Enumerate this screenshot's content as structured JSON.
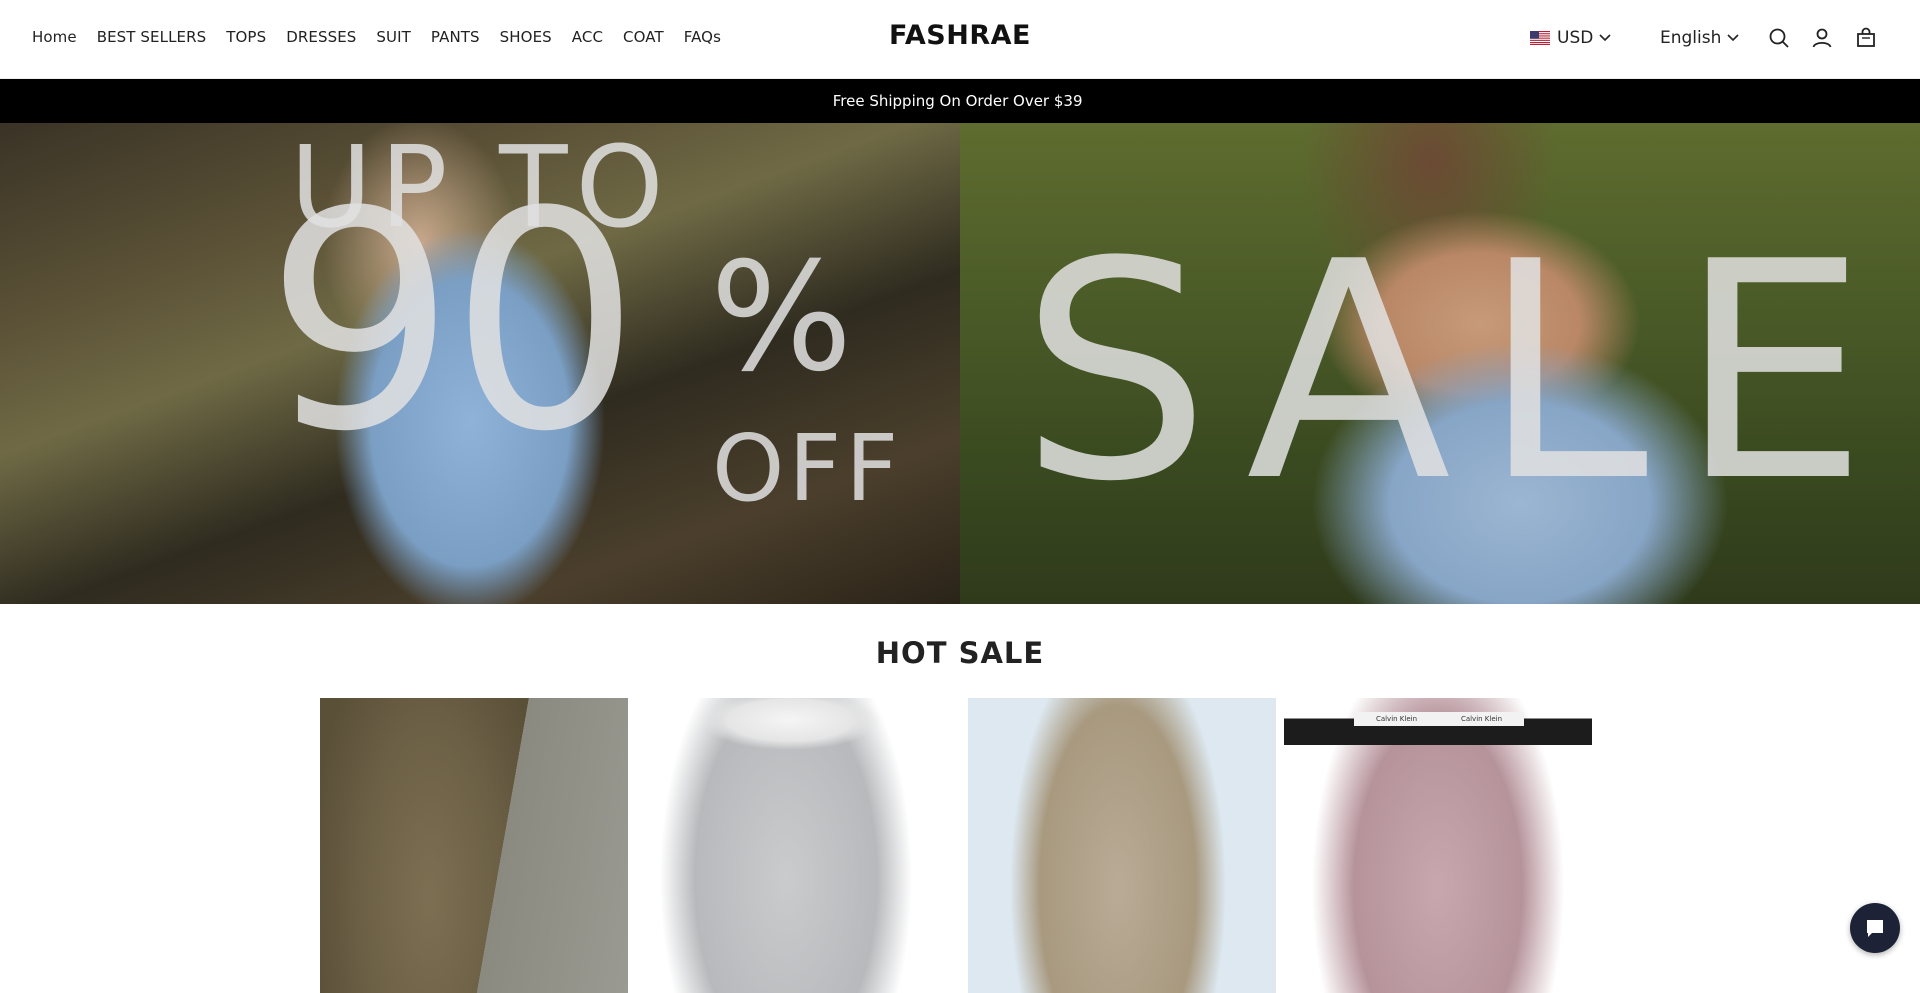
{
  "nav": {
    "items": [
      "Home",
      "BEST SELLERS",
      "TOPS",
      "DRESSES",
      "SUIT",
      "PANTS",
      "SHOES",
      "ACC",
      "COAT",
      "FAQs"
    ]
  },
  "brand": {
    "logo": "FASHRAE"
  },
  "currency": {
    "code": "USD",
    "flag_icon": "us-flag-icon"
  },
  "language": {
    "label": "English"
  },
  "header_icons": [
    "search-icon",
    "account-icon",
    "cart-icon"
  ],
  "announcement": {
    "text": "​​​Free Shipping On Order Over $39 ​​"
  },
  "hero": {
    "line1": "UP TO",
    "big_number": "90",
    "percent": "%",
    "off": "OFF",
    "sale": "SALE"
  },
  "hot_sale": {
    "title": "HOT SALE",
    "waistband_text": "Calvin Klein"
  },
  "colors": {
    "announcement_bg": "#000000",
    "chat_button_bg": "#1e2236"
  }
}
